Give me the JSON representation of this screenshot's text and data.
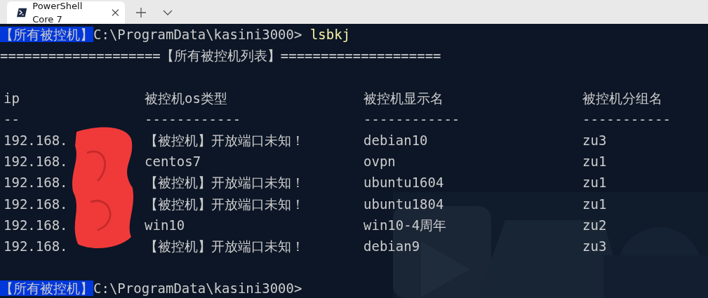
{
  "tabs": [
    {
      "title": "PowerShell Core 7",
      "selected": true
    }
  ],
  "prompt": {
    "label": "【所有被控机】",
    "path": "C:\\ProgramData\\kasini3000>",
    "command": "lsbkj"
  },
  "banner": "====================【所有被控机列表】====================",
  "table": {
    "columns": [
      {
        "header": "ip",
        "rule": "--"
      },
      {
        "header": "被控机os类型",
        "rule": "------------"
      },
      {
        "header": "被控机显示名",
        "rule": "------------"
      },
      {
        "header": "被控机分组名",
        "rule": "-----------"
      }
    ],
    "rows": [
      [
        "192.168.",
        "【被控机】开放端口未知！",
        "debian10",
        "zu3"
      ],
      [
        "192.168.",
        "centos7",
        "ovpn",
        "zu1"
      ],
      [
        "192.168.",
        "【被控机】开放端口未知！",
        "ubuntu1604",
        "zu1"
      ],
      [
        "192.168.",
        "【被控机】开放端口未知！",
        "ubuntu1804",
        "zu1"
      ],
      [
        "192.168.",
        "win10",
        "win10-4周年",
        "zu2"
      ],
      [
        "192.168.",
        "【被控机】开放端口未知！",
        "debian9",
        "zu3"
      ]
    ]
  },
  "prompt_2": {
    "label": "【所有被控机】",
    "path": "C:\\ProgramData\\kasini3000>"
  }
}
